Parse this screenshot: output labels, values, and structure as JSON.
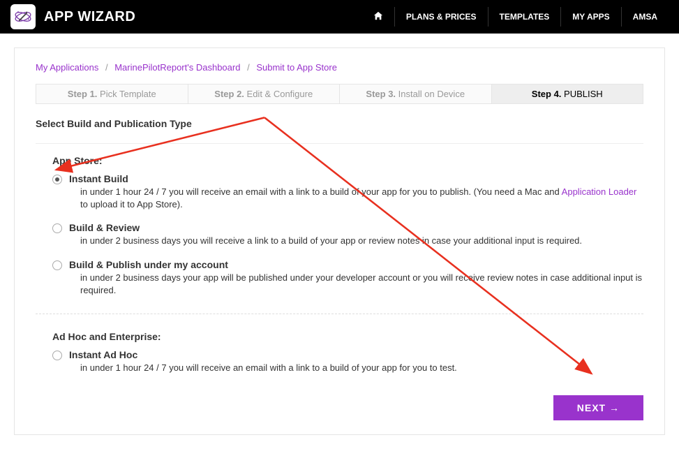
{
  "header": {
    "title": "APP WIZARD",
    "nav": [
      "PLANS & PRICES",
      "TEMPLATES",
      "MY APPS",
      "AMSA"
    ]
  },
  "breadcrumb": {
    "items": [
      "My Applications",
      "MarinePilotReport's Dashboard",
      "Submit to App Store"
    ]
  },
  "steps": [
    {
      "b": "Step 1.",
      "l": "Pick Template"
    },
    {
      "b": "Step 2.",
      "l": "Edit & Configure"
    },
    {
      "b": "Step 3.",
      "l": "Install on Device"
    },
    {
      "b": "Step 4.",
      "l": "PUBLISH"
    }
  ],
  "section_title": "Select Build and Publication Type",
  "app_store": {
    "heading": "App Store:",
    "options": [
      {
        "title": "Instant Build",
        "desc_pre": "in under 1 hour 24 / 7 you will receive an email with a link to a build of your app for you to publish. (You need a Mac and ",
        "link": "Application Loader",
        "desc_post": " to upload it to App Store).",
        "checked": true
      },
      {
        "title": "Build & Review",
        "desc": "in under 2 business days you will receive a link to a build of your app or review notes in case your additional input is required."
      },
      {
        "title": "Build & Publish under my account",
        "desc": "in under 2 business days your app will be published under your developer account or you will receive review notes in case additional input is required."
      }
    ]
  },
  "adhoc": {
    "heading": "Ad Hoc and Enterprise:",
    "options": [
      {
        "title": "Instant Ad Hoc",
        "desc": "in under 1 hour 24 / 7 you will receive an email with a link to a build of your app for you to test."
      }
    ]
  },
  "next_label": "NEXT →"
}
